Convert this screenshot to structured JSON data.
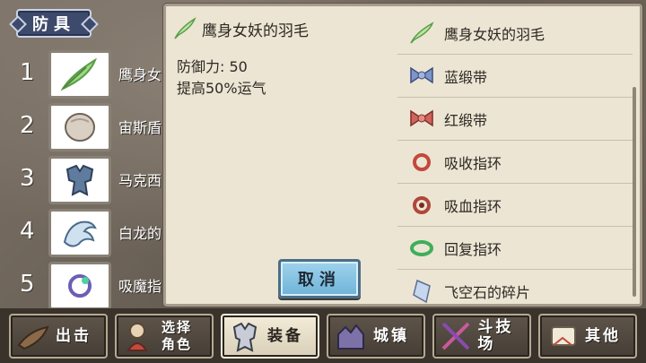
{
  "category": {
    "label": "防具"
  },
  "slots": [
    {
      "num": "1",
      "name": "鹰身女",
      "icon": "feather-icon"
    },
    {
      "num": "2",
      "name": "宙斯盾",
      "icon": "shield-icon"
    },
    {
      "num": "3",
      "name": "马克西",
      "icon": "armor-icon"
    },
    {
      "num": "4",
      "name": "白龙的",
      "icon": "dragon-icon"
    },
    {
      "num": "5",
      "name": "吸魔指",
      "icon": "ring-icon"
    }
  ],
  "detail": {
    "title": "鹰身女妖的羽毛",
    "icon": "feather-icon",
    "stat_line1": "防御力: 50",
    "stat_line2": "提高50%运气"
  },
  "cancel_label": "取消",
  "items": [
    {
      "label": "鹰身女妖的羽毛",
      "icon": "feather-icon"
    },
    {
      "label": "蓝缎带",
      "icon": "blue-ribbon-icon"
    },
    {
      "label": "红缎带",
      "icon": "red-ribbon-icon"
    },
    {
      "label": "吸收指环",
      "icon": "red-ring-icon"
    },
    {
      "label": "吸血指环",
      "icon": "blood-ring-icon"
    },
    {
      "label": "回复指环",
      "icon": "green-ring-icon"
    },
    {
      "label": "飞空石的碎片",
      "icon": "crystal-shard-icon"
    }
  ],
  "nav": [
    {
      "label": "出击",
      "icon": "sortie-icon"
    },
    {
      "label1": "选择",
      "label2": "角色",
      "icon": "character-icon"
    },
    {
      "label": "装备",
      "icon": "equipment-icon",
      "active": true
    },
    {
      "label": "城镇",
      "icon": "town-icon"
    },
    {
      "label": "斗技场",
      "icon": "arena-icon"
    },
    {
      "label": "其他",
      "icon": "other-icon"
    }
  ],
  "colors": {
    "panel": "#ece5d3",
    "cancel_button": "#8ec8e6",
    "category_tab": "#3e4a6b",
    "active_nav": "#efe7d2"
  }
}
